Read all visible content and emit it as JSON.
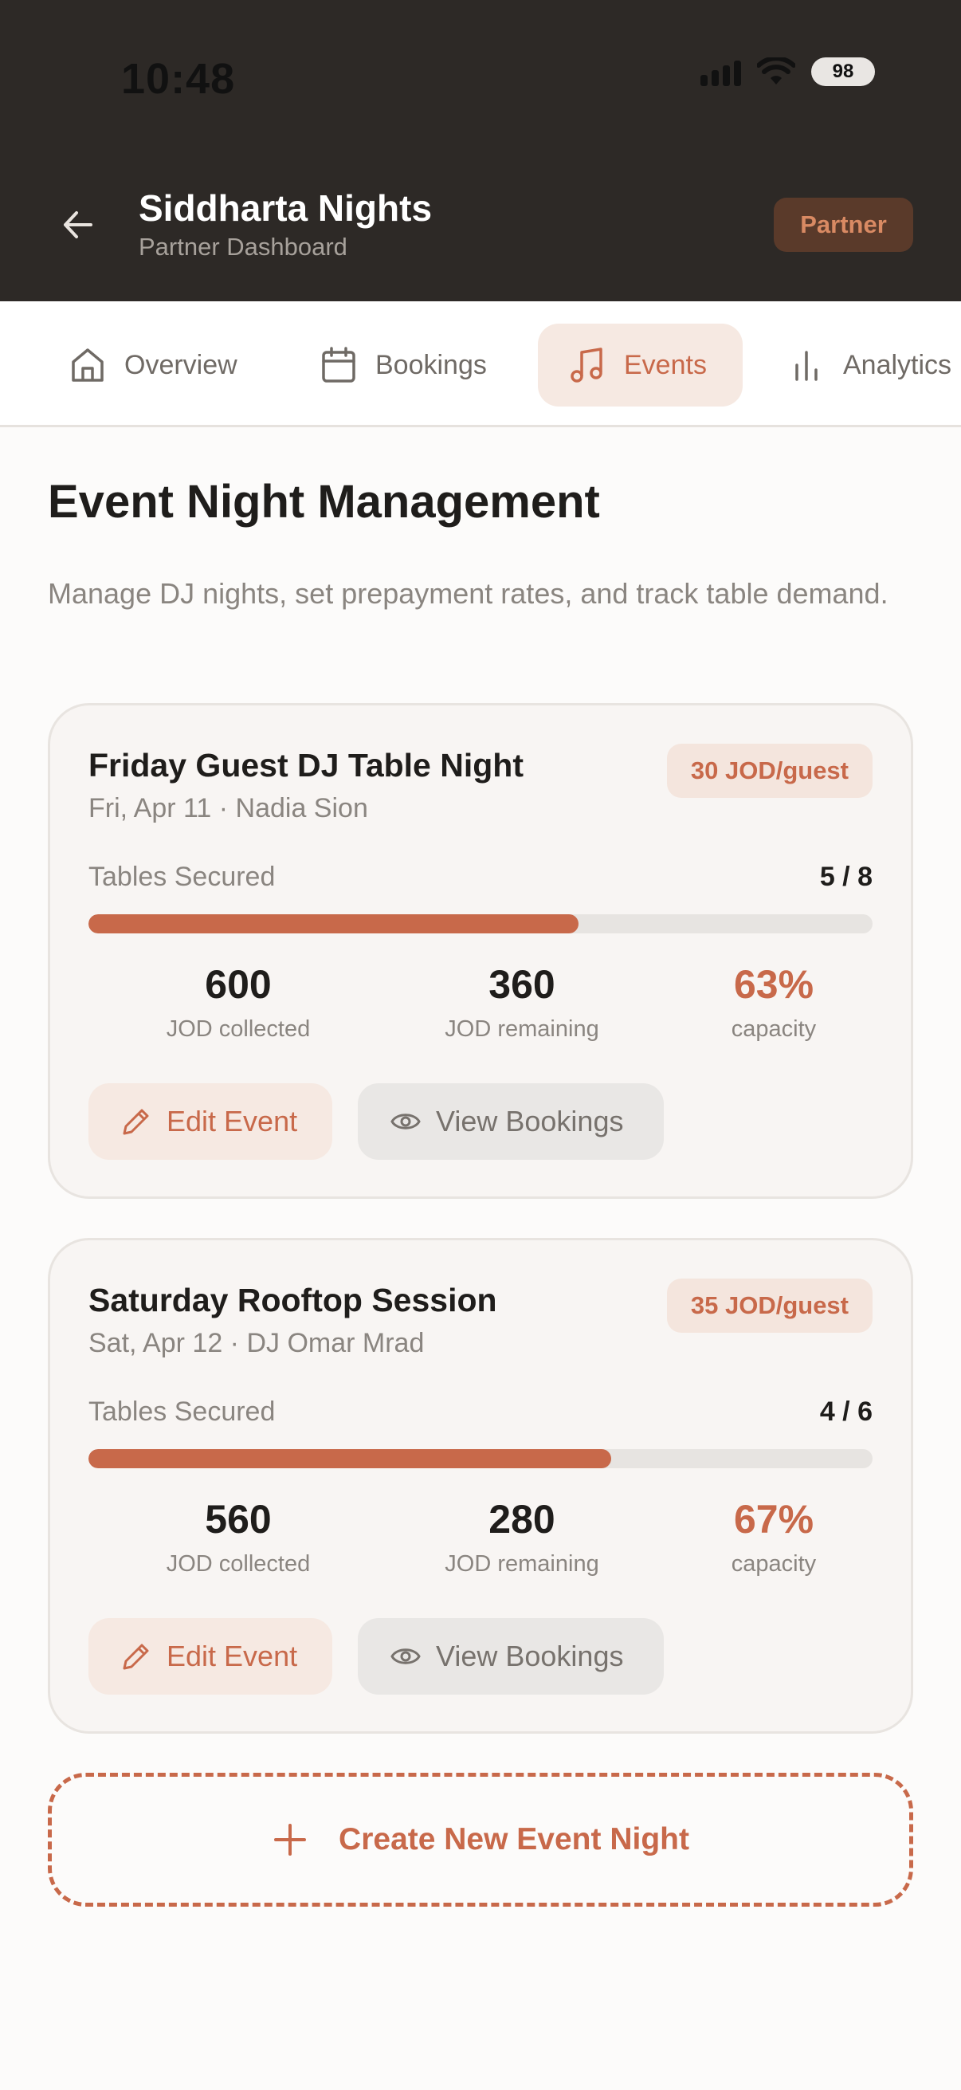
{
  "status_bar": {
    "time": "10:48",
    "battery": "98"
  },
  "header": {
    "title": "Siddharta Nights",
    "subtitle": "Partner Dashboard",
    "badge": "Partner"
  },
  "tabs": [
    {
      "label": "Overview",
      "icon": "home-icon",
      "active": false
    },
    {
      "label": "Bookings",
      "icon": "calendar-icon",
      "active": false
    },
    {
      "label": "Events",
      "icon": "music-note-icon",
      "active": true
    },
    {
      "label": "Analytics",
      "icon": "bar-chart-icon",
      "active": false
    }
  ],
  "page": {
    "title": "Event Night Management",
    "description": "Manage DJ nights, set prepayment rates, and track table demand."
  },
  "events": [
    {
      "title": "Friday Guest DJ Table Night",
      "meta": "Fri, Apr 11 · Nadia Sion",
      "price": "30 JOD/guest",
      "tables_label": "Tables Secured",
      "tables_count": "5 / 8",
      "progress_fraction": 0.625,
      "stats": [
        {
          "value": "600",
          "label": "JOD collected",
          "accent": false
        },
        {
          "value": "360",
          "label": "JOD remaining",
          "accent": false
        },
        {
          "value": "63%",
          "label": "capacity",
          "accent": true
        }
      ],
      "edit_label": "Edit Event",
      "view_label": "View Bookings"
    },
    {
      "title": "Saturday Rooftop Session",
      "meta": "Sat, Apr 12 · DJ Omar Mrad",
      "price": "35 JOD/guest",
      "tables_label": "Tables Secured",
      "tables_count": "4 / 6",
      "progress_fraction": 0.667,
      "stats": [
        {
          "value": "560",
          "label": "JOD collected",
          "accent": false
        },
        {
          "value": "280",
          "label": "JOD remaining",
          "accent": false
        },
        {
          "value": "67%",
          "label": "capacity",
          "accent": true
        }
      ],
      "edit_label": "Edit Event",
      "view_label": "View Bookings"
    }
  ],
  "create_button": {
    "label": "Create New Event Night"
  },
  "colors": {
    "accent": "#C8694A",
    "header_bg": "#2D2926",
    "page_bg": "#FCFBFA"
  }
}
